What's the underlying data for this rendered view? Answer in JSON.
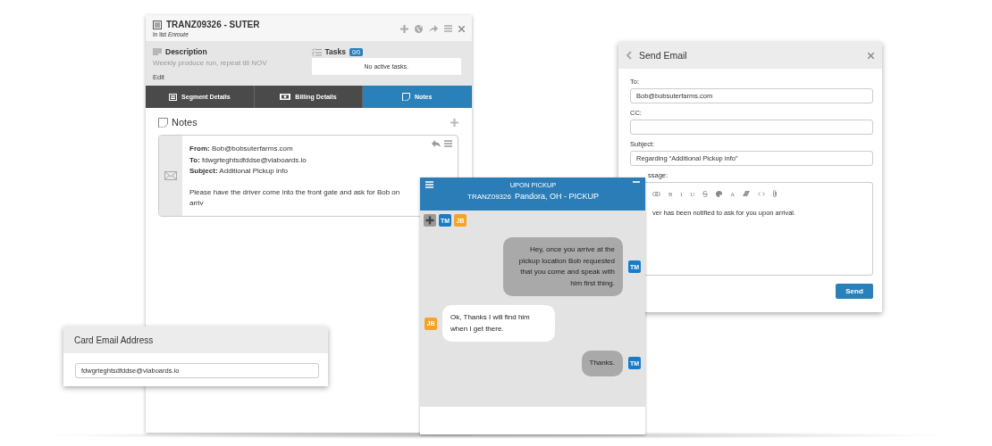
{
  "ticket_panel": {
    "title": "TRANZ09326 - SUTER",
    "subtitle": "In list *Enroute*",
    "description": {
      "heading": "Description",
      "text": "Weekly produce run, repeat till NOV",
      "link": "Edit"
    },
    "tasks": {
      "heading": "Tasks",
      "count": "0/0",
      "empty_text": "No active tasks."
    },
    "tabs": [
      {
        "label": "Segment Details",
        "selected": false
      },
      {
        "label": "Billing Details",
        "selected": false
      },
      {
        "label": "Notes",
        "selected": true
      }
    ],
    "notes": {
      "heading": "Notes",
      "items": [
        {
          "fields": [
            {
              "label": "From:",
              "value": "Bob@bobsuterfarms.com"
            },
            {
              "label": "To:",
              "value": "fdwgrteghtsdfddse@viaboards.io"
            },
            {
              "label": "Subject:",
              "value": "Additional Pickup info"
            }
          ],
          "body": "Please have the driver come into the front gate and ask for Bob on arriv"
        }
      ]
    }
  },
  "chat": {
    "title": "UPON PICKUP",
    "reference": "TRANZ09326",
    "location": "Pandora, OH - PICKUP",
    "participants": [
      {
        "initials": "TM",
        "color": "#1a7cc4"
      },
      {
        "initials": "JB",
        "color": "#f5a425"
      }
    ],
    "messages": [
      {
        "kind": "sent",
        "text": "Hey, once you arrive at the pickup location Bob requested that you come and speak with him first thing.",
        "author": "TM",
        "color": "#1a7cc4"
      },
      {
        "kind": "received",
        "text": "Ok, Thanks I will find him when I get there.",
        "author": "JB",
        "color": "#f5a425"
      },
      {
        "kind": "sent",
        "text": "Thanks.",
        "author": "TM",
        "color": "#1a7cc4"
      }
    ]
  },
  "send_email": {
    "title": "Send Email",
    "fields": [
      {
        "label": "To:",
        "value": "Bob@bobsuterfarms.com"
      },
      {
        "label": "CC:"
      },
      {
        "label": "Subject:",
        "value": "Regarding “Additional Pickup info”"
      }
    ],
    "message": {
      "label": "ssage:",
      "toolbar": [
        {
          "kind": "icon"
        },
        {
          "kind": "glyph",
          "text": "B"
        },
        {
          "kind": "glyph",
          "text": "I"
        },
        {
          "kind": "glyph",
          "text": "U"
        },
        {
          "kind": "icon"
        },
        {
          "kind": "icon"
        },
        {
          "kind": "glyph",
          "text": "A"
        },
        {
          "kind": "icon"
        },
        {
          "kind": "icon"
        },
        {
          "kind": "icon"
        }
      ],
      "text": "ver has been notified to ask for you upon arrival."
    },
    "send_button": "Send"
  },
  "card_email": {
    "title": "Card Email Address",
    "value": "fdwgrteghtsdfddse@viaboards.io"
  }
}
